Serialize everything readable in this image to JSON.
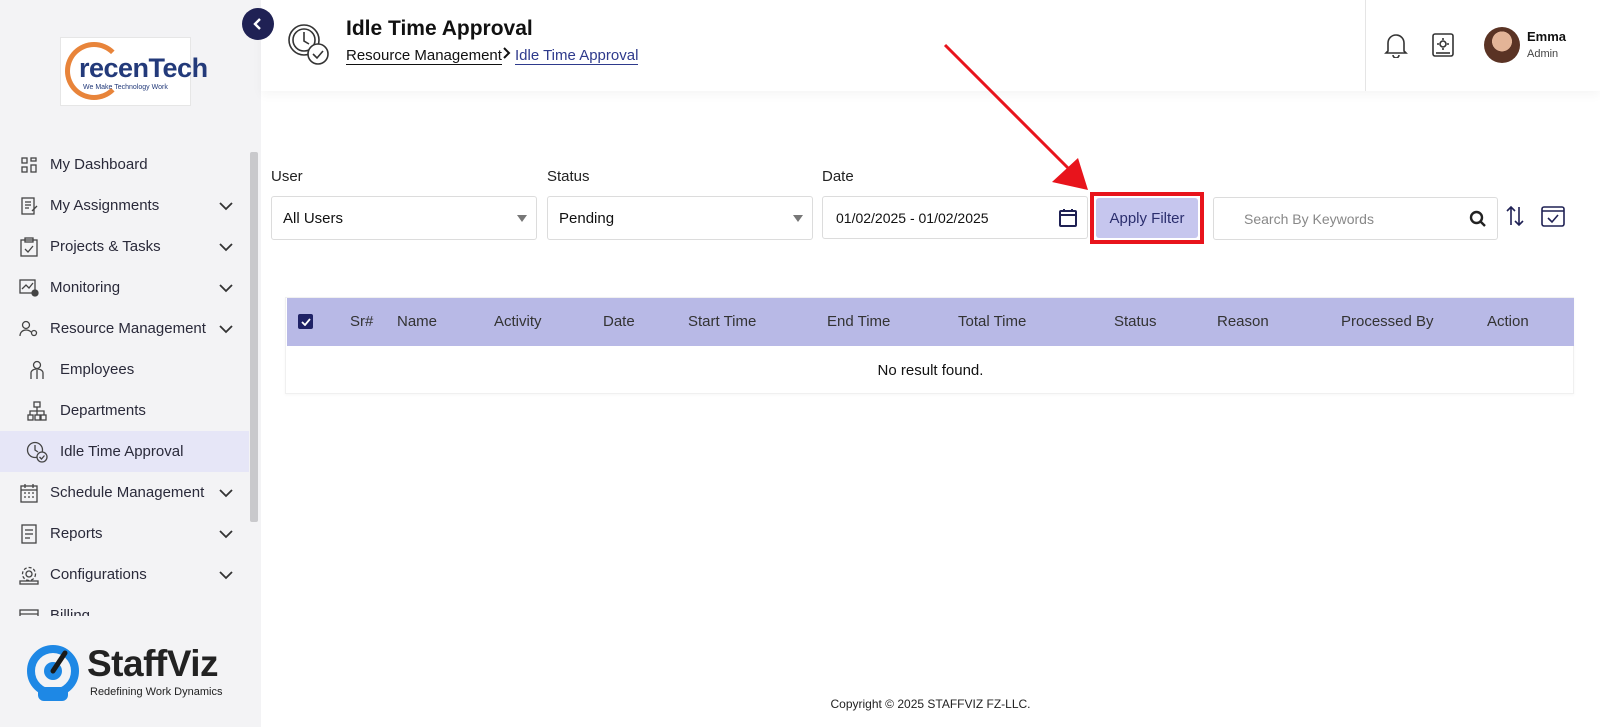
{
  "sidebar": {
    "logo": {
      "brand": "recenTech",
      "tagline": "We Make Technology Work"
    },
    "items": [
      {
        "label": "My Dashboard",
        "icon": "dashboard-icon",
        "expandable": false
      },
      {
        "label": "My Assignments",
        "icon": "assignments-icon",
        "expandable": true
      },
      {
        "label": "Projects & Tasks",
        "icon": "clipboard-check-icon",
        "expandable": true
      },
      {
        "label": "Monitoring",
        "icon": "monitoring-icon",
        "expandable": true
      },
      {
        "label": "Resource Management",
        "icon": "users-gear-icon",
        "expandable": true
      },
      {
        "label": "Employees",
        "icon": "employee-icon",
        "expandable": false,
        "sub": true
      },
      {
        "label": "Departments",
        "icon": "org-chart-icon",
        "expandable": false,
        "sub": true
      },
      {
        "label": "Idle Time Approval",
        "icon": "clock-check-icon",
        "expandable": false,
        "sub": true,
        "active": true
      },
      {
        "label": "Schedule Management",
        "icon": "calendar-icon",
        "expandable": true
      },
      {
        "label": "Reports",
        "icon": "report-icon",
        "expandable": true
      },
      {
        "label": "Configurations",
        "icon": "config-icon",
        "expandable": true
      },
      {
        "label": "Billing",
        "icon": "billing-icon",
        "expandable": false
      }
    ],
    "brand": {
      "name": "StaffViz",
      "tagline": "Redefining Work Dynamics"
    }
  },
  "header": {
    "title": "Idle Time Approval",
    "breadcrumb": [
      "Resource Management",
      "Idle Time Approval"
    ],
    "user": {
      "name": "Emma",
      "role": "Admin"
    }
  },
  "filters": {
    "user_label": "User",
    "user_value": "All Users",
    "status_label": "Status",
    "status_value": "Pending",
    "date_label": "Date",
    "date_value": "01/02/2025 - 01/02/2025",
    "apply_label": "Apply Filter",
    "search_placeholder": "Search By Keywords"
  },
  "table": {
    "columns": [
      "Sr#",
      "Name",
      "Activity",
      "Date",
      "Start Time",
      "End Time",
      "Total Time",
      "Status",
      "Reason",
      "Processed By",
      "Action"
    ],
    "empty_text": "No result found."
  },
  "footer": {
    "copyright": "Copyright © 2025 STAFFVIZ FZ-LLC."
  },
  "colors": {
    "accent": "#1f2154",
    "table_header": "#b8b9e6",
    "highlight": "#e8141c",
    "apply_button": "#c6c6ee"
  }
}
